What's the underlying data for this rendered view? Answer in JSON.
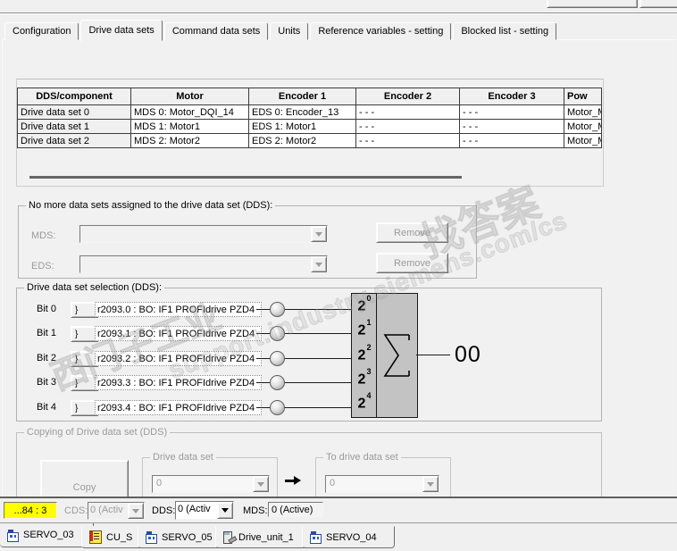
{
  "tabs": {
    "items": [
      "Configuration",
      "Drive data sets",
      "Command data sets",
      "Units",
      "Reference variables - setting",
      "Blocked list - setting"
    ],
    "active": "Drive data sets"
  },
  "table": {
    "columns": [
      "DDS/component",
      "Motor",
      "Encoder 1",
      "Encoder 2",
      "Encoder 3",
      "Pow"
    ],
    "rows": [
      [
        "Drive data set 0",
        "MDS 0: Motor_DQI_14",
        "EDS 0: Encoder_13",
        "- - -",
        "- - -",
        "Motor_M"
      ],
      [
        "Drive data set 1",
        "MDS 1: Motor1",
        "EDS 1: Motor1",
        "- - -",
        "- - -",
        "Motor_M"
      ],
      [
        "Drive data set 2",
        "MDS 2: Motor2",
        "EDS 2: Motor2",
        "- - -",
        "- - -",
        "Motor_M"
      ]
    ]
  },
  "assign_group": {
    "title": "No more data sets assigned to the drive data set (DDS):",
    "mds_label": "MDS:",
    "eds_label": "EDS:",
    "mds_value": "",
    "eds_value": "",
    "remove_label": "Remove"
  },
  "dds_selection": {
    "title": "Drive data set selection (DDS):",
    "power_base": "2",
    "bico_glyph": "}",
    "bits": [
      {
        "label": "Bit 0",
        "source": "r2093.0 : BO: IF1 PROFIdrive PZD4",
        "exp": "0"
      },
      {
        "label": "Bit 1",
        "source": "r2093.1 : BO: IF1 PROFIdrive PZD4",
        "exp": "1"
      },
      {
        "label": "Bit 2",
        "source": "r2093.2 : BO: IF1 PROFIdrive PZD4",
        "exp": "2"
      },
      {
        "label": "Bit 3",
        "source": "r2093.3 : BO: IF1 PROFIdrive PZD4",
        "exp": "3"
      },
      {
        "label": "Bit 4",
        "source": "r2093.4 : BO: IF1 PROFIdrive PZD4",
        "exp": "4"
      }
    ],
    "sum_output": "00"
  },
  "copy_group": {
    "title": "Copying of Drive data set (DDS)",
    "copy_label": "Copy",
    "from_title": "Drive data set",
    "to_title": "To drive data set",
    "from_value": "0",
    "to_value": "0"
  },
  "status_bar": {
    "param_field": "...84 : 3",
    "cds_label": "CDS:",
    "cds_value": "0 (Activ",
    "dds_label": "DDS:",
    "dds_value": "0 (Activ",
    "mds_label": "MDS:",
    "mds_value": "0 (Active)"
  },
  "bottom_tabs": [
    {
      "label": "SERVO_03",
      "icon": "servo-icon"
    },
    {
      "label": "CU_S",
      "icon": "cu-icon"
    },
    {
      "label": "SERVO_05",
      "icon": "servo-icon"
    },
    {
      "label": "Drive_unit_1",
      "icon": "drive-unit-icon"
    },
    {
      "label": "SERVO_04",
      "icon": "servo-icon"
    }
  ],
  "watermarks": [
    "support.industry.siemens.com/cs",
    "西门子工业",
    "找答案"
  ],
  "colors": {
    "highlight_yellow": "#ffff00",
    "sum_block_gray": "#c3c3c3",
    "page_background": "#f1f1f1"
  }
}
